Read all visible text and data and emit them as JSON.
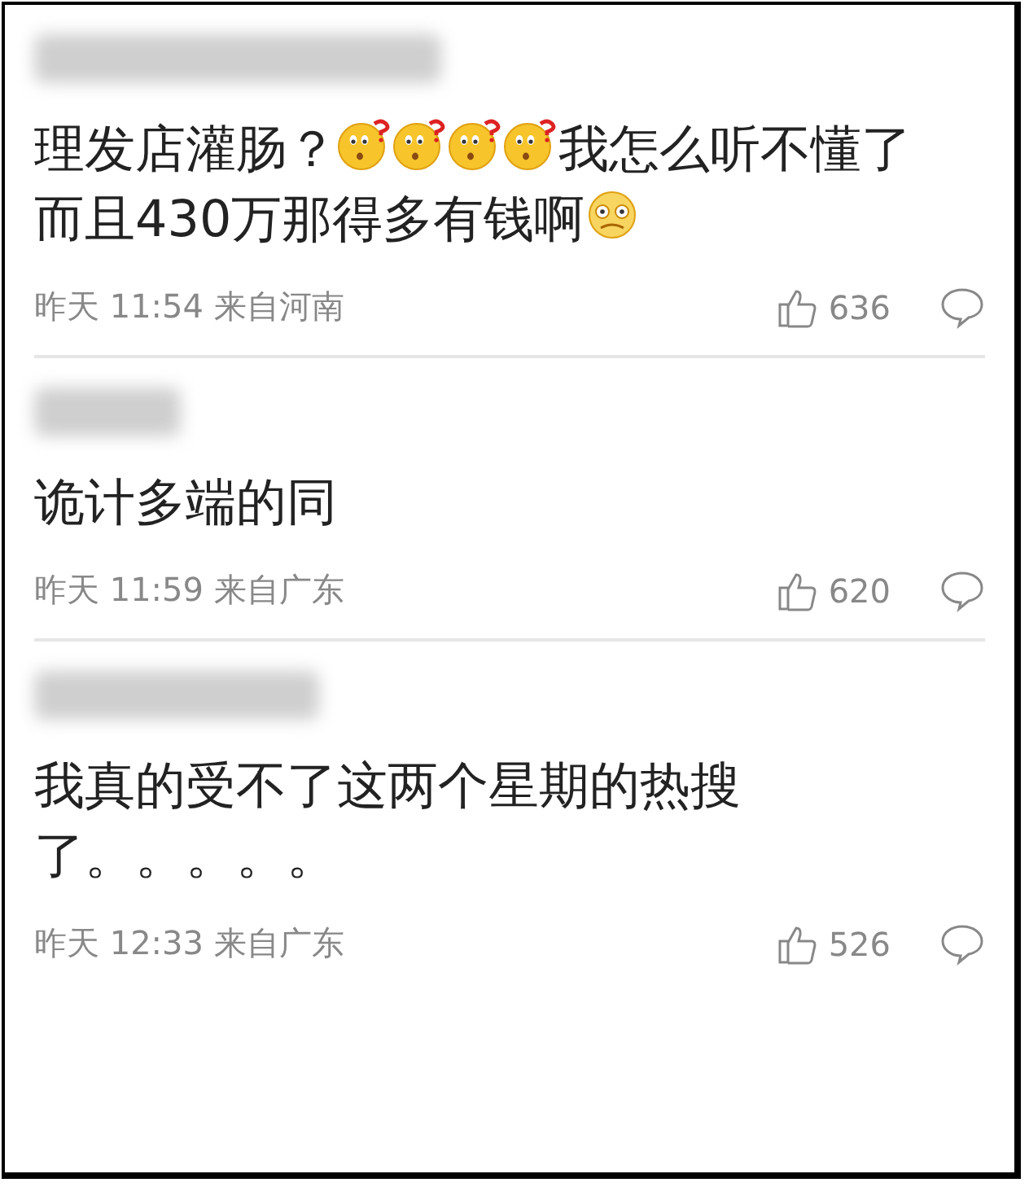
{
  "comments": [
    {
      "body": [
        {
          "kind": "text",
          "text": "理发店灌肠？"
        },
        {
          "kind": "confused"
        },
        {
          "kind": "confused"
        },
        {
          "kind": "confused"
        },
        {
          "kind": "confused"
        },
        {
          "kind": "text",
          "text": "我怎么听不懂了"
        },
        {
          "kind": "text",
          "text": "而且430万那得多有钱啊"
        },
        {
          "kind": "dizzy"
        }
      ],
      "time": "昨天 11:54 来自河南",
      "likes": "636"
    },
    {
      "body": [
        {
          "kind": "text",
          "text": "诡计多端的同"
        }
      ],
      "time": "昨天 11:59 来自广东",
      "likes": "620"
    },
    {
      "body": [
        {
          "kind": "text",
          "text": "我真的受不了这两个星期的热搜了。。。。。"
        }
      ],
      "time": "昨天 12:33 来自广东",
      "likes": "526"
    }
  ]
}
